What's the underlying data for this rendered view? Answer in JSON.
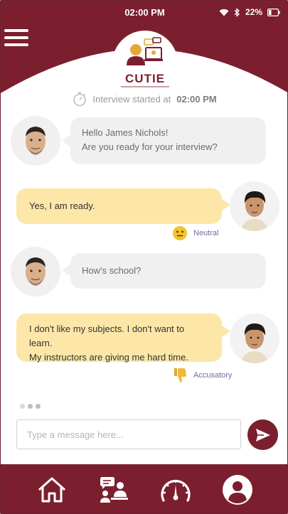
{
  "status_bar": {
    "time": "02:00 PM",
    "battery": "22%"
  },
  "header": {
    "logo_text": "CUTIE"
  },
  "interview": {
    "started_prefix": "Interview started at",
    "started_time": "02:00 PM"
  },
  "messages": [
    {
      "sender": "interviewer",
      "lines": [
        "Hello James Nichols!",
        "Are you ready for your interview?"
      ]
    },
    {
      "sender": "user",
      "lines": [
        "Yes, I am ready."
      ],
      "sentiment": "Neutral",
      "sentiment_icon": "neutral-face-icon"
    },
    {
      "sender": "interviewer",
      "lines": [
        "How's school?"
      ]
    },
    {
      "sender": "user",
      "lines": [
        "I don't like my subjects. I don't want to learn.",
        "My instructors are giving me hard time."
      ],
      "sentiment": "Accusatory",
      "sentiment_icon": "thumbs-down-icon"
    }
  ],
  "composer": {
    "placeholder": "Type a message here..."
  },
  "nav": [
    {
      "name": "home",
      "icon": "home-icon"
    },
    {
      "name": "interview",
      "icon": "interview-icon"
    },
    {
      "name": "dashboard",
      "icon": "gauge-icon"
    },
    {
      "name": "profile",
      "icon": "profile-icon"
    }
  ],
  "colors": {
    "brand": "#7b1f2e",
    "user_bubble": "#fce7a8",
    "bot_bubble": "#f0f0f0",
    "sentiment_text": "#6d6fa0"
  }
}
